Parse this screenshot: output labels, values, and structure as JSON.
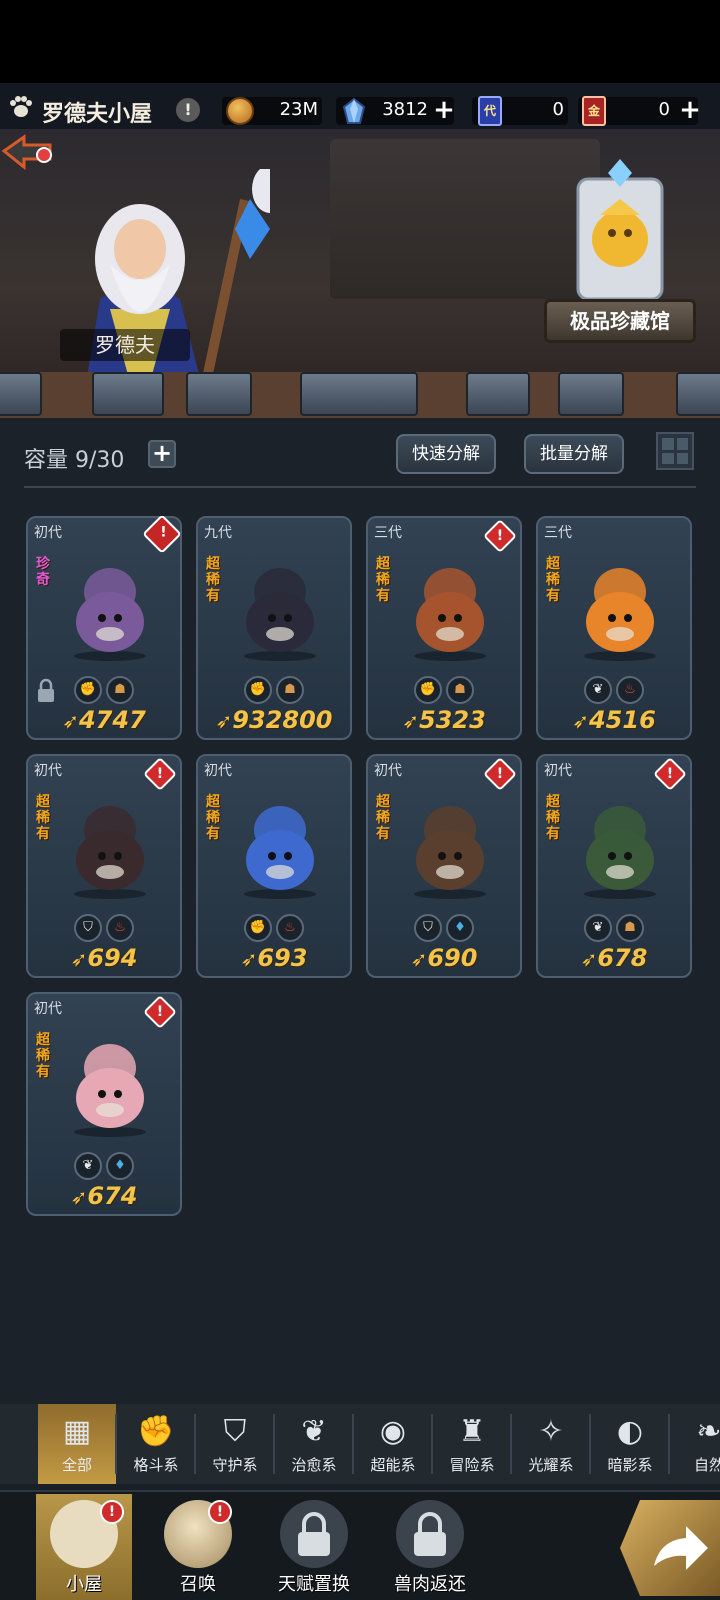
{
  "header": {
    "title": "罗德夫小屋",
    "warn": "!",
    "gold": "23M",
    "crystals": "3812",
    "ticket1": "0",
    "ticket2": "0",
    "ticket1_glyph": "代",
    "ticket2_glyph": "金"
  },
  "scene": {
    "npc_name": "罗德夫",
    "vault_label": "极品珍藏馆"
  },
  "inventory": {
    "capacity_label": "容量 9/30",
    "quick_dismantle": "快速分解",
    "batch_dismantle": "批量分解"
  },
  "cards": [
    {
      "gen": "初代",
      "rarity": "珍奇",
      "power": "4747",
      "alert": true,
      "locked": true,
      "tags": [
        "格斗",
        "冒险"
      ],
      "color": "#7a5a9a"
    },
    {
      "gen": "九代",
      "rarity": "超稀有",
      "power": "932800",
      "alert": false,
      "locked": false,
      "tags": [
        "格斗",
        "冒险"
      ],
      "color": "#2a2a3a"
    },
    {
      "gen": "三代",
      "rarity": "超稀有",
      "power": "5323",
      "alert": true,
      "locked": false,
      "tags": [
        "格斗",
        "冒险"
      ],
      "color": "#a6542e"
    },
    {
      "gen": "三代",
      "rarity": "超稀有",
      "power": "4516",
      "alert": false,
      "locked": false,
      "tags": [
        "治愈",
        "火"
      ],
      "color": "#e8842a"
    },
    {
      "gen": "初代",
      "rarity": "超稀有",
      "power": "694",
      "alert": true,
      "locked": false,
      "tags": [
        "守护",
        "火"
      ],
      "color": "#3a2a2e"
    },
    {
      "gen": "初代",
      "rarity": "超稀有",
      "power": "693",
      "alert": false,
      "locked": false,
      "tags": [
        "格斗",
        "火"
      ],
      "color": "#3e6ad0"
    },
    {
      "gen": "初代",
      "rarity": "超稀有",
      "power": "690",
      "alert": true,
      "locked": false,
      "tags": [
        "守护",
        "水"
      ],
      "color": "#5a3e2e"
    },
    {
      "gen": "初代",
      "rarity": "超稀有",
      "power": "678",
      "alert": true,
      "locked": false,
      "tags": [
        "治愈",
        "冒险"
      ],
      "color": "#3a5a3a"
    },
    {
      "gen": "初代",
      "rarity": "超稀有",
      "power": "674",
      "alert": true,
      "locked": false,
      "tags": [
        "治愈",
        "水"
      ],
      "color": "#e6a8b4"
    }
  ],
  "categories": [
    {
      "label": "全部",
      "icon": "▦"
    },
    {
      "label": "格斗系",
      "icon": "✊"
    },
    {
      "label": "守护系",
      "icon": "⛉"
    },
    {
      "label": "治愈系",
      "icon": "❦"
    },
    {
      "label": "超能系",
      "icon": "◉"
    },
    {
      "label": "冒险系",
      "icon": "♜"
    },
    {
      "label": "光耀系",
      "icon": "✧"
    },
    {
      "label": "暗影系",
      "icon": "◐"
    },
    {
      "label": "自然",
      "icon": "❧"
    }
  ],
  "nav": [
    {
      "label": "小屋",
      "badge": "!"
    },
    {
      "label": "召唤",
      "badge": "!"
    },
    {
      "label": "天赋置换",
      "badge": ""
    },
    {
      "label": "兽肉返还",
      "badge": ""
    }
  ],
  "colors": {
    "accent_gold": "#f3c34a",
    "alert_red": "#d02a2a",
    "card_bg": "#2c3b4a",
    "rarity_orange": "#f0a820",
    "rarity_purple": "#e05ad8"
  }
}
